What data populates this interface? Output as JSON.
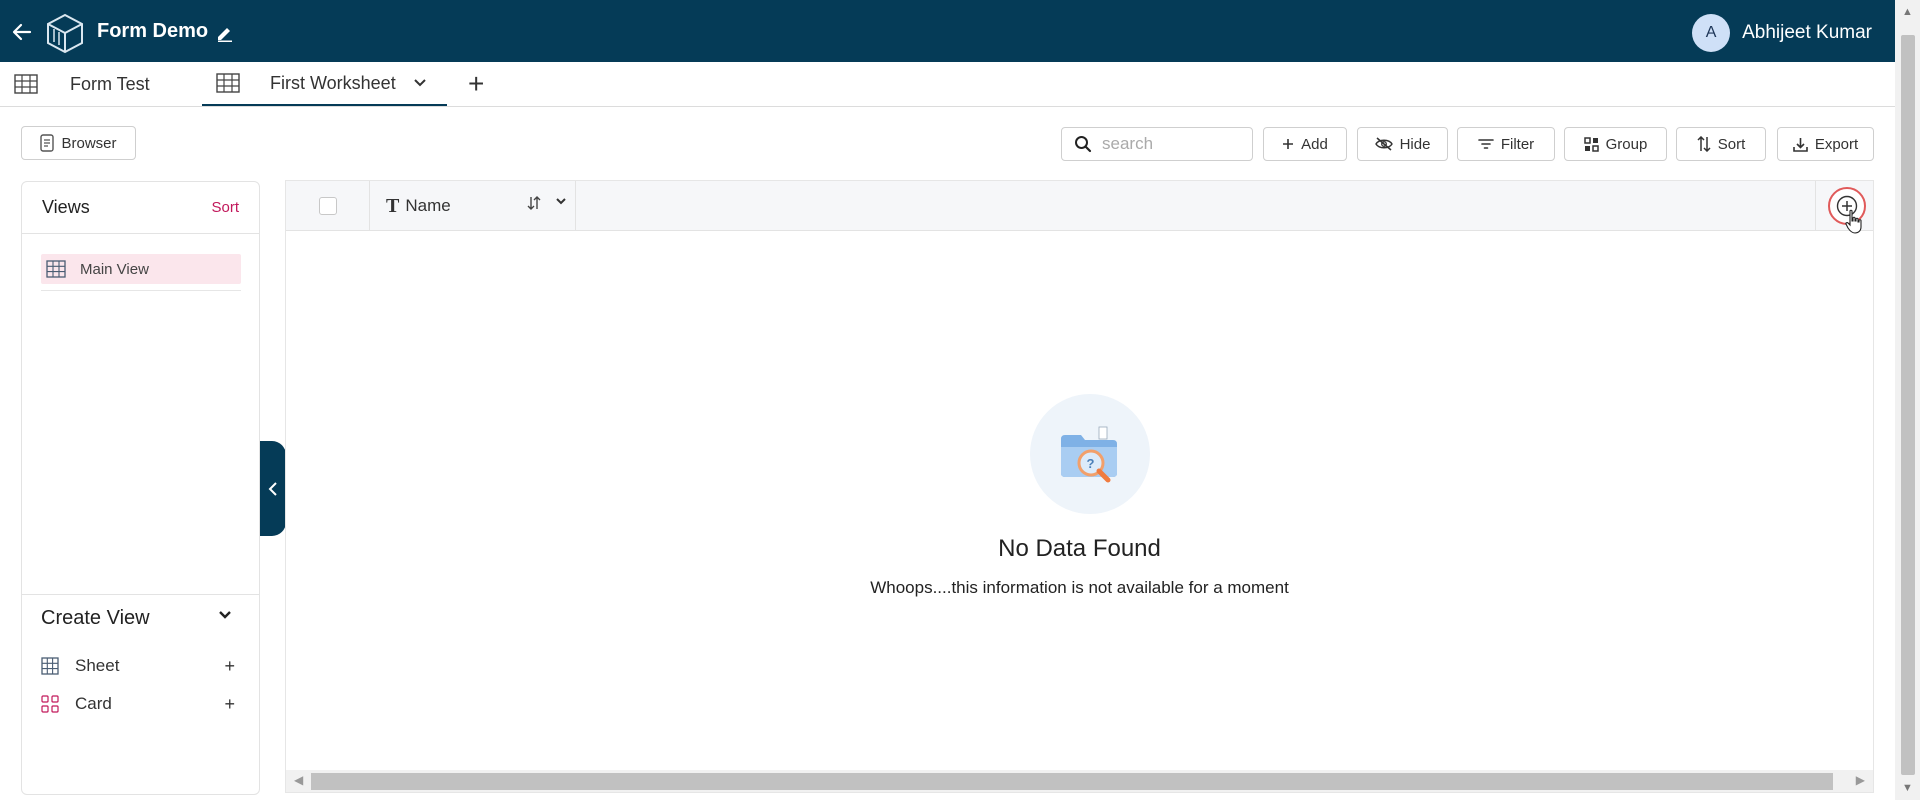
{
  "header": {
    "app_title": "Form Demo",
    "user_initial": "A",
    "user_name": "Abhijeet Kumar"
  },
  "tabs": [
    {
      "label": "Form Test",
      "active": false
    },
    {
      "label": "First Worksheet",
      "active": true
    }
  ],
  "toolbar": {
    "browser_label": "Browser",
    "search_placeholder": "search",
    "add_label": "Add",
    "hide_label": "Hide",
    "filter_label": "Filter",
    "group_label": "Group",
    "sort_label": "Sort",
    "export_label": "Export"
  },
  "views_panel": {
    "title": "Views",
    "sort_label": "Sort",
    "items": [
      {
        "label": "Main View"
      }
    ],
    "create_title": "Create View",
    "create_items": [
      {
        "label": "Sheet",
        "icon": "grid-icon"
      },
      {
        "label": "Card",
        "icon": "card-icon"
      }
    ]
  },
  "grid": {
    "columns": [
      {
        "label": "Name"
      }
    ],
    "empty_title": "No Data Found",
    "empty_subtitle": "Whoops....this information is not available for a moment"
  },
  "colors": {
    "brand": "#053b57",
    "accent": "#c2185b",
    "selected_view_bg": "#fbe6ec"
  }
}
